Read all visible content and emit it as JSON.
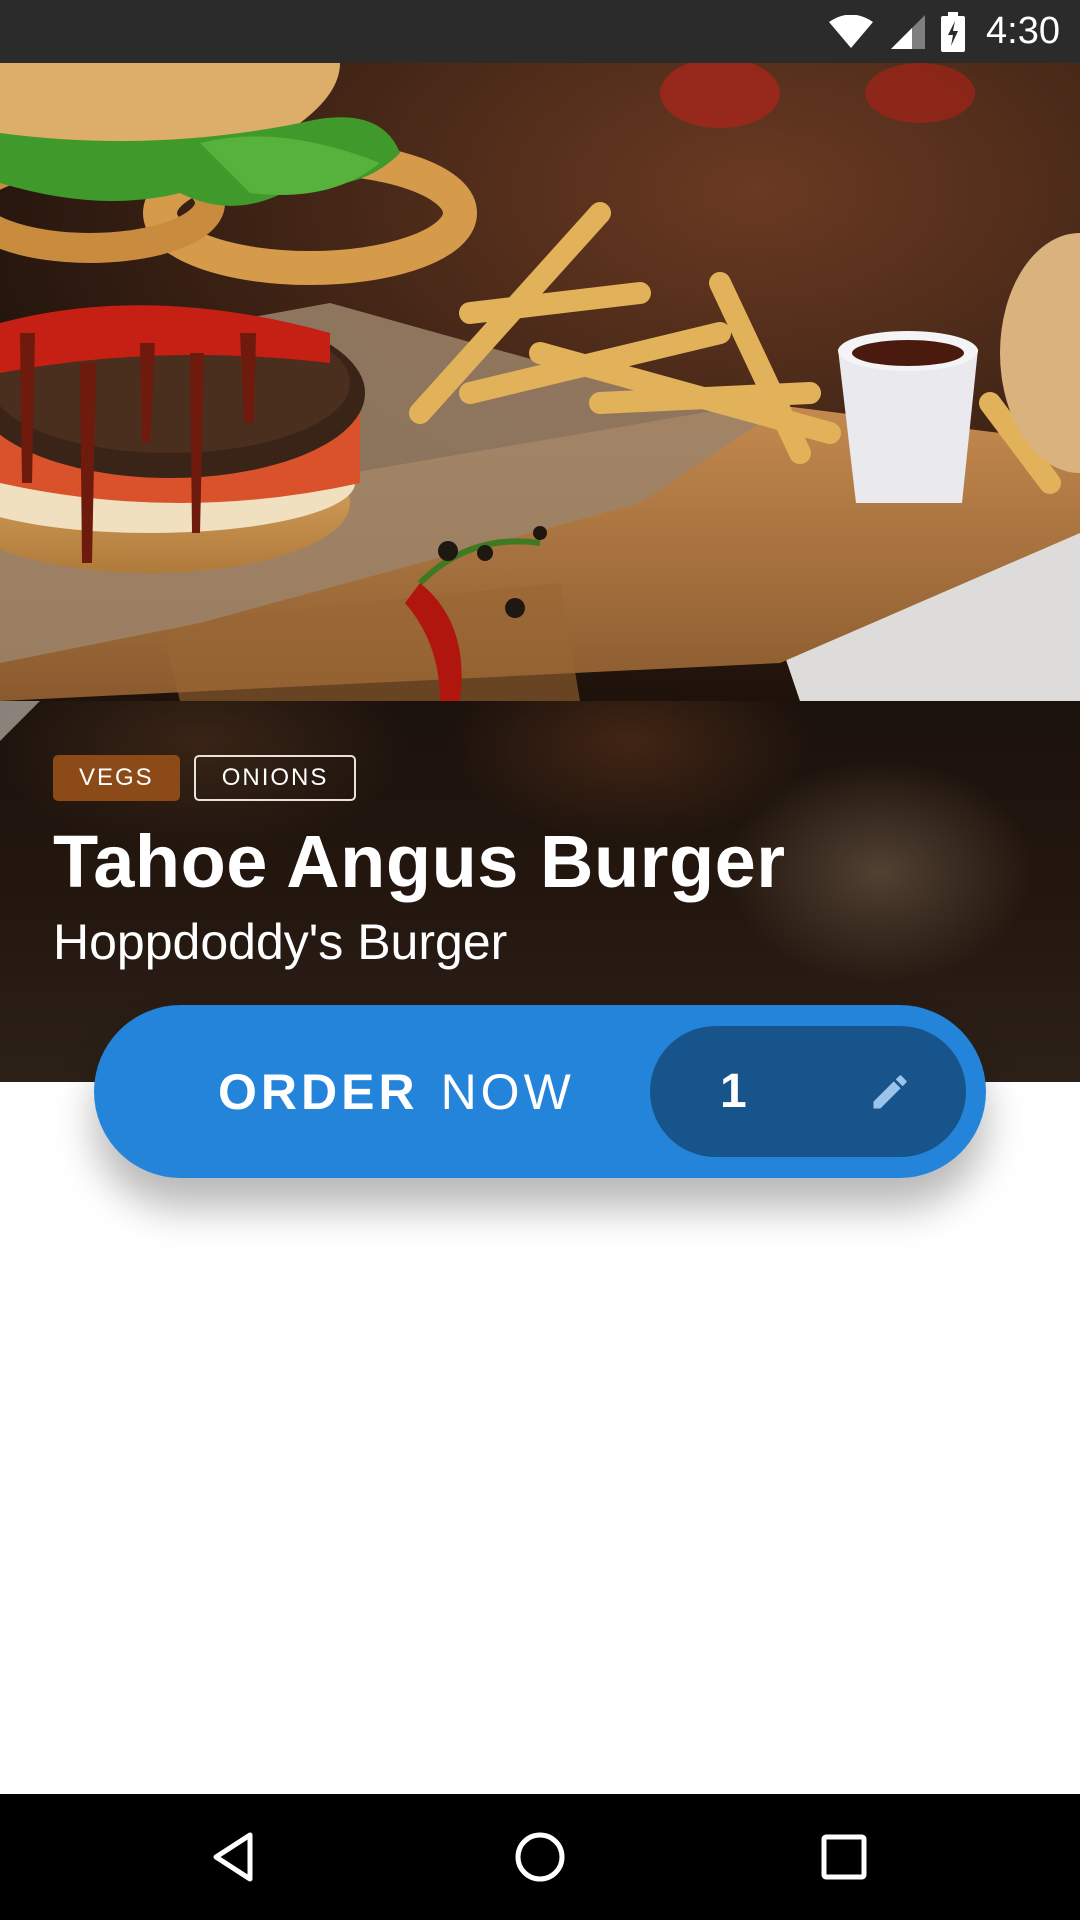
{
  "status_bar": {
    "time": "4:30",
    "icons": [
      "wifi-icon",
      "signal-icon",
      "battery-charging-icon"
    ]
  },
  "hero": {
    "image": "burger-and-fries-photo"
  },
  "tags": [
    {
      "label": "VEGS"
    },
    {
      "label": "ONIONS"
    }
  ],
  "product": {
    "title": "Tahoe Angus Burger",
    "restaurant": "Hoppdoddy's Burger"
  },
  "order": {
    "label_bold": "ORDER",
    "label_light": "NOW",
    "quantity": "1",
    "edit_icon": "pencil-icon"
  },
  "nav_bar": {
    "icons": [
      "back-icon",
      "home-icon",
      "recents-icon"
    ]
  },
  "colors": {
    "accent": "#2484d9",
    "accent_dark": "#17548c",
    "tag_fill": "#8b4a17",
    "status_bar": "#2b2b2b",
    "nav_bar": "#000000"
  }
}
